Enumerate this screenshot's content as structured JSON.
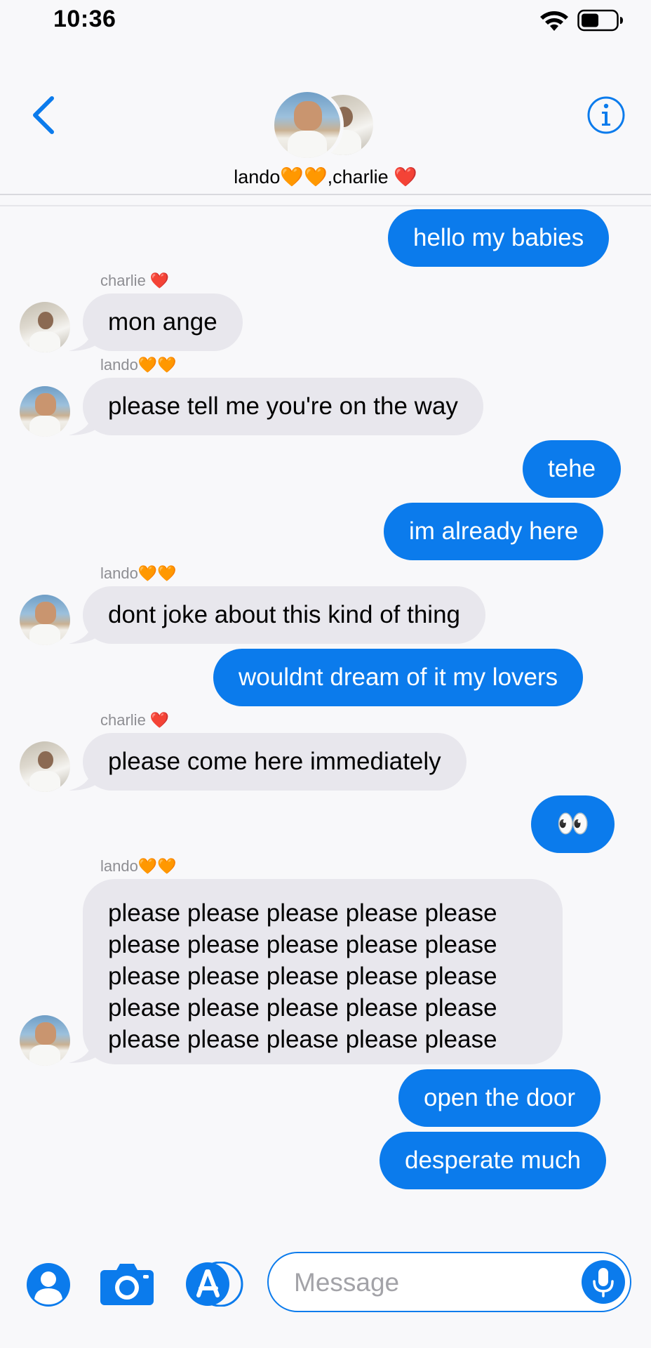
{
  "status_bar": {
    "time": "10:36"
  },
  "header": {
    "group_name": "lando🧡🧡,charlie ❤️"
  },
  "conversation": {
    "senders": {
      "charlie": "charlie ❤️",
      "lando": "lando🧡🧡"
    },
    "messages": [
      {
        "text": "hello my babies"
      },
      {
        "text": "mon ange"
      },
      {
        "text": "please tell me you're on the way"
      },
      {
        "text": "tehe"
      },
      {
        "text": "im already here"
      },
      {
        "text": "dont joke about this kind of thing"
      },
      {
        "text": "wouldnt dream of it my lovers"
      },
      {
        "text": "please come here immediately"
      },
      {
        "text": "👀"
      },
      {
        "text": "please please please please please please please please please please please please please please please please please please please please please please please please please"
      },
      {
        "text": "open the door"
      },
      {
        "text": "desperate much"
      }
    ]
  },
  "composer": {
    "placeholder": "Message"
  },
  "colors": {
    "accent": "#0b7bec",
    "incoming_bubble": "#e8e7ed",
    "background": "#f8f8fa"
  },
  "icons": [
    "wifi-icon",
    "battery-icon",
    "back-chevron-icon",
    "info-icon",
    "contact-icon",
    "camera-icon",
    "app-store-icon",
    "microphone-icon"
  ]
}
